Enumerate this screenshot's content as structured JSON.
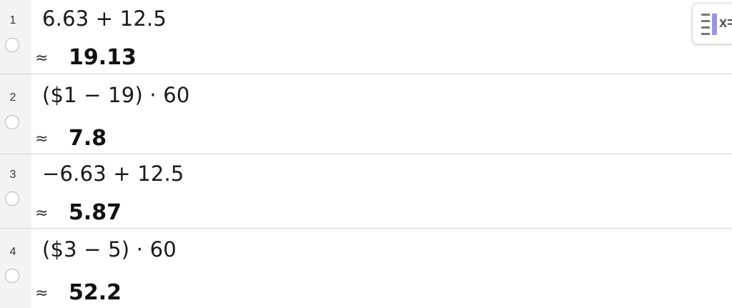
{
  "cas": {
    "rows": [
      {
        "number": "1",
        "input": "6.63 + 12.5",
        "approx_symbol": "≈",
        "output": "19.13"
      },
      {
        "number": "2",
        "input": "($1 − 19) · 60",
        "approx_symbol": "≈",
        "output": "7.8"
      },
      {
        "number": "3",
        "input": "−6.63 + 12.5",
        "approx_symbol": "≈",
        "output": "5.87"
      },
      {
        "number": "4",
        "input": "($3 − 5) · 60",
        "approx_symbol": "≈",
        "output": "52.2"
      }
    ]
  },
  "toolbar": {
    "keyboard_toggle_label": "x=",
    "keyboard_toggle_icon": "algebra-view-icon"
  }
}
